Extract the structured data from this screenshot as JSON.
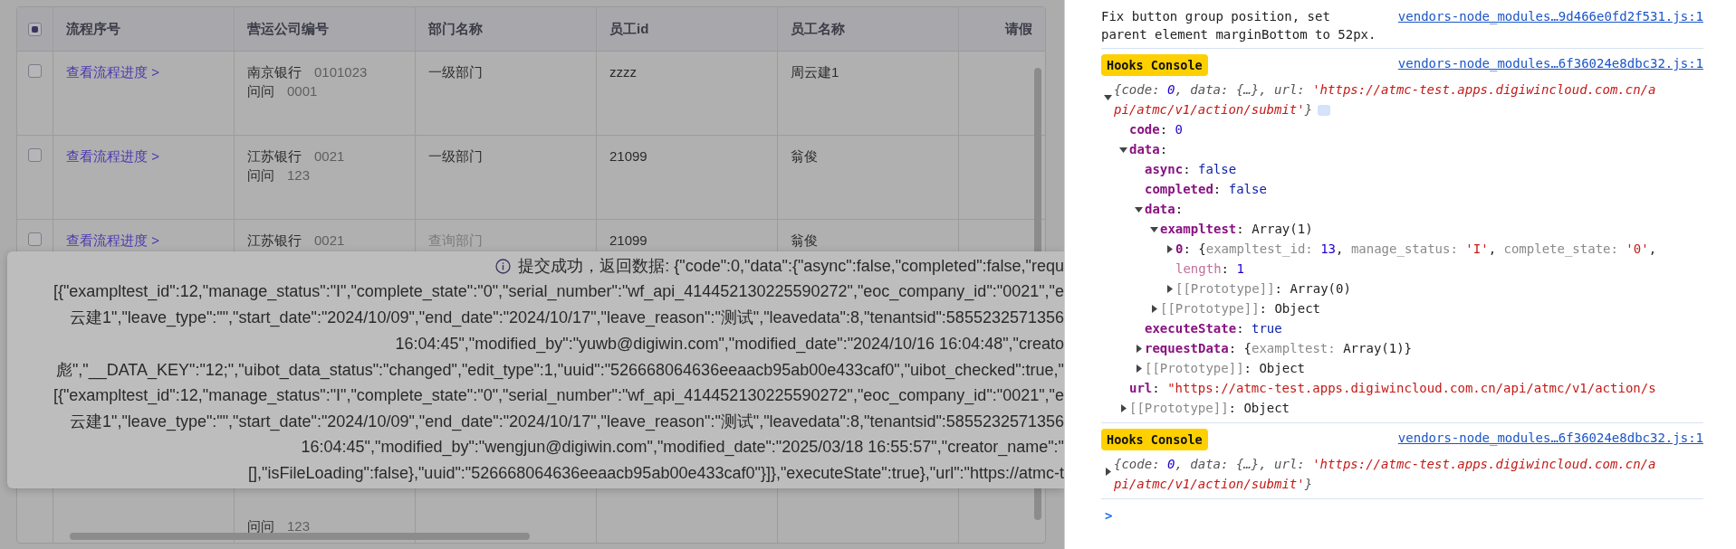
{
  "table": {
    "header_checkbox": {
      "indeterminate": true
    },
    "columns": [
      "流程序号",
      "营运公司编号",
      "部门名称",
      "员工id",
      "员工名称",
      "请假"
    ],
    "rows": [
      {
        "kind": "full",
        "checked": false,
        "link": "查看流程进度 >",
        "company": [
          {
            "name": "南京银行",
            "code": "0101023"
          },
          {
            "name": "问问",
            "code": "0001"
          }
        ],
        "dept": "一级部门",
        "dept_muted": false,
        "emp_id": "zzzz",
        "emp_name": "周云建1"
      },
      {
        "kind": "full",
        "checked": false,
        "link": "查看流程进度 >",
        "company": [
          {
            "name": "江苏银行",
            "code": "0021"
          },
          {
            "name": "问问",
            "code": "123"
          }
        ],
        "dept": "一级部门",
        "dept_muted": false,
        "emp_id": "21099",
        "emp_name": "翁俊"
      },
      {
        "kind": "full",
        "checked": false,
        "link": "查看流程进度 >",
        "company": [
          {
            "name": "江苏银行",
            "code": "0021"
          }
        ],
        "dept": "查询部门",
        "dept_muted": true,
        "emp_id": "21099",
        "emp_name": "翁俊"
      },
      {
        "kind": "partial",
        "company": [
          {
            "name": "问问",
            "code": "123"
          }
        ]
      }
    ]
  },
  "toast": {
    "lines": [
      "提交成功，返回数据: {\"code\":0,\"data\":{\"async\":false,\"completed\":false,\"requ",
      "[{\"exampltest_id\":12,\"manage_status\":\"I\",\"complete_state\":\"0\",\"serial_number\":\"wf_api_414452130225590272\",\"eoc_company_id\":\"0021\",\"e",
      "云建1\",\"leave_type\":\"\",\"start_date\":\"2024/10/09\",\"end_date\":\"2024/10/17\",\"leave_reason\":\"测试\",\"leavedata\":8,\"tenantsid\":5855232571356",
      "16:04:45\",\"modified_by\":\"yuwb@digiwin.com\",\"modified_date\":\"2024/10/16 16:04:48\",\"creato",
      "彪\",\"__DATA_KEY\":\"12;\",\"uibot_data_status\":\"changed\",\"edit_type\":1,\"uuid\":\"526668064636eeaacb95ab00e433caf0\",\"uibot_checked\":true,\"",
      "[{\"exampltest_id\":12,\"manage_status\":\"I\",\"complete_state\":\"0\",\"serial_number\":\"wf_api_414452130225590272\",\"eoc_company_id\":\"0021\",\"e",
      "云建1\",\"leave_type\":\"\",\"start_date\":\"2024/10/09\",\"end_date\":\"2024/10/17\",\"leave_reason\":\"测试\",\"leavedata\":8,\"tenantsid\":5855232571356",
      "16:04:45\",\"modified_by\":\"wengjun@digiwin.com\",\"modified_date\":\"2025/03/18 16:55:57\",\"creator_name\":\"",
      "[],\"isFileLoading\":false},\"uuid\":\"526668064636eeaacb95ab00e433caf0\"}]},\"executeState\":true},\"url\":\"https://atmc-t"
    ]
  },
  "console": {
    "messages": [
      {
        "kind": "log",
        "text": "Fix button group position, set parent element marginBottom to 52px.",
        "source": "vendors-node_modules…9d466e0fd2f531.js:1"
      },
      {
        "kind": "hooks",
        "badge": "Hooks Console",
        "source": "vendors-node_modules…6f36024e8dbc32.js:1",
        "expanded": true,
        "summary": [
          {
            "text": "{code: ",
            "kind": "text"
          },
          {
            "text": "0",
            "kind": "number"
          },
          {
            "text": ", data: {…}, url: ",
            "kind": "text"
          },
          {
            "text": "'https://atmc-test.apps.digiwincloud.com.cn/api/atmc/v1/action/submit'",
            "kind": "string"
          },
          {
            "text": "}",
            "kind": "text"
          }
        ],
        "tree": [
          {
            "key": "code",
            "kind": "own",
            "value": [
              {
                "text": ": ",
                "kind": "text"
              },
              {
                "text": "0",
                "kind": "number"
              }
            ]
          },
          {
            "key": "data",
            "kind": "own",
            "expanded": true,
            "value": [
              {
                "text": ":",
                "kind": "text"
              }
            ],
            "children": [
              {
                "key": "async",
                "kind": "own",
                "value": [
                  {
                    "text": ": ",
                    "kind": "text"
                  },
                  {
                    "text": "false",
                    "kind": "bool"
                  }
                ]
              },
              {
                "key": "completed",
                "kind": "own",
                "value": [
                  {
                    "text": ": ",
                    "kind": "text"
                  },
                  {
                    "text": "false",
                    "kind": "bool"
                  }
                ]
              },
              {
                "key": "data",
                "kind": "own",
                "expanded": true,
                "value": [
                  {
                    "text": ":",
                    "kind": "text"
                  }
                ],
                "children": [
                  {
                    "key": "exampltest",
                    "kind": "own",
                    "expanded": true,
                    "value": [
                      {
                        "text": ": Array(1)",
                        "kind": "text"
                      }
                    ],
                    "children": [
                      {
                        "key": "0",
                        "kind": "own",
                        "expanded": false,
                        "value": [
                          {
                            "text": ": {",
                            "kind": "text"
                          },
                          {
                            "text": "exampltest_id: ",
                            "kind": "key"
                          },
                          {
                            "text": "13",
                            "kind": "number"
                          },
                          {
                            "text": ", ",
                            "kind": "text"
                          },
                          {
                            "text": "manage_status: ",
                            "kind": "key"
                          },
                          {
                            "text": "'I'",
                            "kind": "string"
                          },
                          {
                            "text": ", ",
                            "kind": "text"
                          },
                          {
                            "text": "complete_state: ",
                            "kind": "key"
                          },
                          {
                            "text": "'0'",
                            "kind": "string"
                          },
                          {
                            "text": ",",
                            "kind": "text"
                          }
                        ]
                      },
                      {
                        "key": "length",
                        "kind": "meta",
                        "value": [
                          {
                            "text": ": ",
                            "kind": "text"
                          },
                          {
                            "text": "1",
                            "kind": "number"
                          }
                        ]
                      },
                      {
                        "key": "[[Prototype]]",
                        "kind": "proto",
                        "expanded": false,
                        "value": [
                          {
                            "text": ": Array(0)",
                            "kind": "text"
                          }
                        ]
                      }
                    ]
                  },
                  {
                    "key": "[[Prototype]]",
                    "kind": "proto",
                    "expanded": false,
                    "value": [
                      {
                        "text": ": Object",
                        "kind": "text"
                      }
                    ]
                  }
                ]
              },
              {
                "key": "executeState",
                "kind": "own",
                "value": [
                  {
                    "text": ": ",
                    "kind": "text"
                  },
                  {
                    "text": "true",
                    "kind": "bool"
                  }
                ]
              },
              {
                "key": "requestData",
                "kind": "own",
                "expanded": false,
                "value": [
                  {
                    "text": ": {",
                    "kind": "text"
                  },
                  {
                    "text": "exampltest: ",
                    "kind": "key"
                  },
                  {
                    "text": "Array(1)}",
                    "kind": "text"
                  }
                ]
              },
              {
                "key": "[[Prototype]]",
                "kind": "proto",
                "expanded": false,
                "value": [
                  {
                    "text": ": Object",
                    "kind": "text"
                  }
                ]
              }
            ]
          },
          {
            "key": "url",
            "kind": "own",
            "value": [
              {
                "text": ": ",
                "kind": "text"
              },
              {
                "text": "\"https://atmc-test.apps.digiwincloud.com.cn/api/atmc/v1/action/s",
                "kind": "string"
              }
            ]
          },
          {
            "key": "[[Prototype]]",
            "kind": "proto",
            "expanded": false,
            "value": [
              {
                "text": ": Object",
                "kind": "text"
              }
            ]
          }
        ]
      },
      {
        "kind": "hooks",
        "badge": "Hooks Console",
        "source": "vendors-node_modules…6f36024e8dbc32.js:1",
        "expanded": false,
        "summary": [
          {
            "text": "{code: ",
            "kind": "text"
          },
          {
            "text": "0",
            "kind": "number"
          },
          {
            "text": ", data: {…}, url: ",
            "kind": "text"
          },
          {
            "text": "'https://atmc-test.apps.digiwincloud.com.cn/api/atmc/v1/action/submit'",
            "kind": "string"
          },
          {
            "text": "}",
            "kind": "text"
          }
        ]
      }
    ],
    "prompt": ">"
  }
}
